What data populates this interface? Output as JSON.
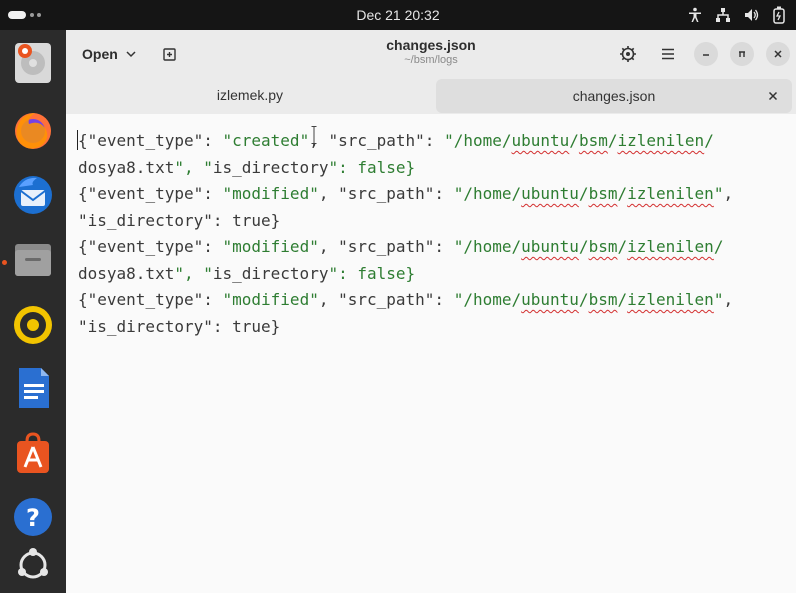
{
  "topbar": {
    "clock": "Dec 21  20:32",
    "tray_icons": [
      "accessibility-icon",
      "network-icon",
      "volume-icon",
      "battery-icon"
    ]
  },
  "dock": {
    "apps": [
      {
        "name": "ubuntu-dock-disk-icon"
      },
      {
        "name": "firefox-icon"
      },
      {
        "name": "thunderbird-icon"
      },
      {
        "name": "files-icon"
      },
      {
        "name": "rhythmbox-icon"
      },
      {
        "name": "writer-icon"
      },
      {
        "name": "app-center-icon"
      },
      {
        "name": "help-icon"
      },
      {
        "name": "show-apps-icon"
      }
    ]
  },
  "window": {
    "open_label": "Open",
    "title": "changes.json",
    "subtitle": "~/bsm/logs"
  },
  "tabs": [
    {
      "label": "izlemek.py",
      "active": false
    },
    {
      "label": "changes.json",
      "active": true
    }
  ],
  "editor": {
    "lines": [
      "{\"event_type\": \"created\", \"src_path\": \"/home/ubuntu/bsm/izlenilen/",
      "dosya8.txt\", \"is_directory\": false}",
      "{\"event_type\": \"modified\", \"src_path\": \"/home/ubuntu/bsm/izlenilen\",",
      "\"is_directory\": true}",
      "{\"event_type\": \"modified\", \"src_path\": \"/home/ubuntu/bsm/izlenilen/",
      "dosya8.txt\", \"is_directory\": false}",
      "{\"event_type\": \"modified\", \"src_path\": \"/home/ubuntu/bsm/izlenilen\",",
      "\"is_directory\": true}"
    ]
  },
  "colors": {
    "accent": "#e95420",
    "string": "#2e7d32",
    "spell_error": "#d32f2f"
  }
}
